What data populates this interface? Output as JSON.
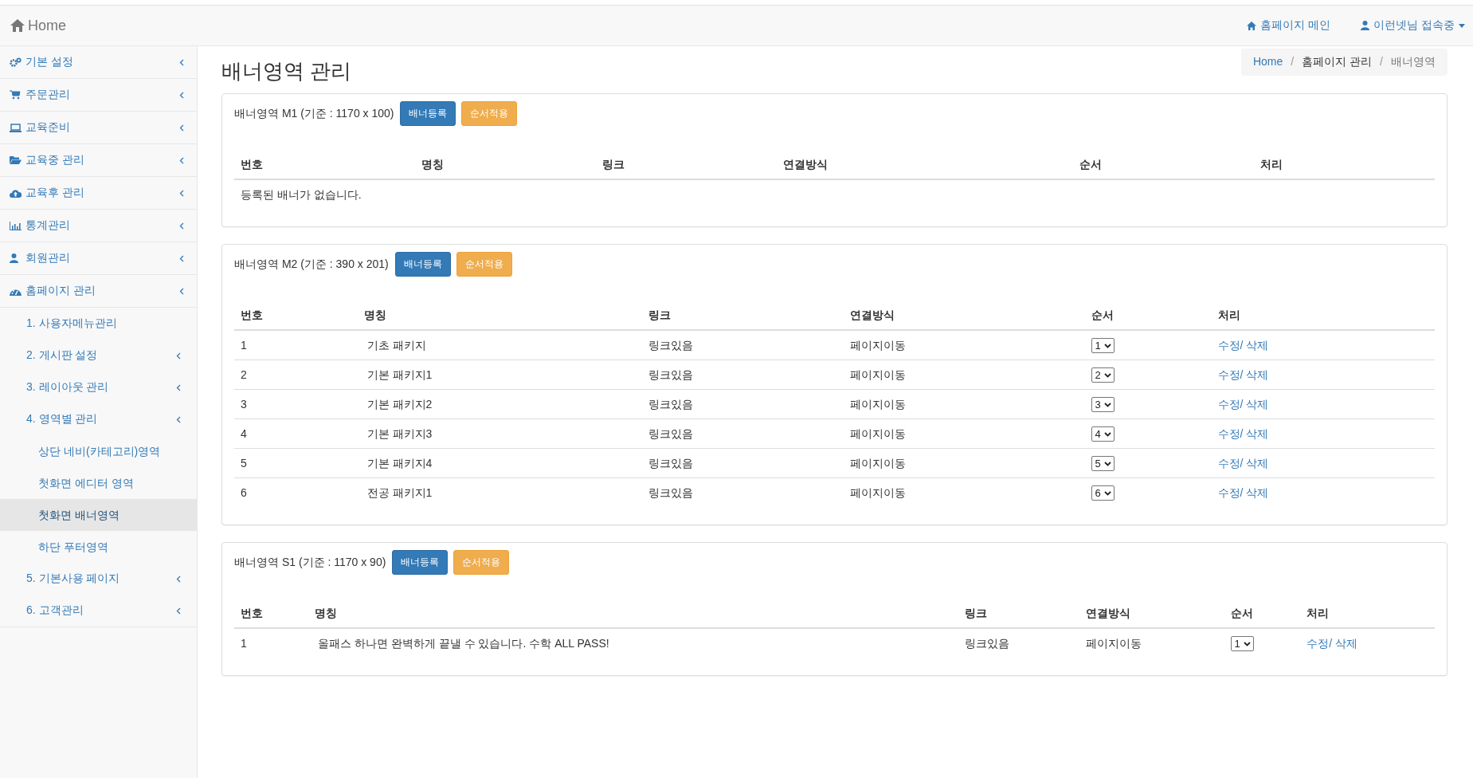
{
  "navbar": {
    "brand": "Home",
    "links": [
      {
        "label": "홈페이지 메인"
      },
      {
        "label": "이런넷님 접속중",
        "dropdown": true
      }
    ]
  },
  "sidebar": {
    "items": [
      {
        "label": "기본 설정",
        "has_submenu": true
      },
      {
        "label": "주문관리",
        "has_submenu": true
      },
      {
        "label": "교육준비",
        "has_submenu": true
      },
      {
        "label": "교육중 관리",
        "has_submenu": true
      },
      {
        "label": "교육후 관리",
        "has_submenu": true
      },
      {
        "label": "통계관리",
        "has_submenu": true
      },
      {
        "label": "회원관리",
        "has_submenu": true
      },
      {
        "label": "홈페이지 관리",
        "has_submenu": true,
        "children": [
          {
            "label": "1. 사용자메뉴관리",
            "has_submenu": false
          },
          {
            "label": "2. 게시판 설정",
            "has_submenu": true
          },
          {
            "label": "3. 레이아웃 관리",
            "has_submenu": true
          },
          {
            "label": "4. 영역별 관리",
            "has_submenu": true,
            "children": [
              {
                "label": "상단 네비(카테고리)영역",
                "selected": false
              },
              {
                "label": "첫화면 에디터 영역",
                "selected": false
              },
              {
                "label": "첫화면 배너영역",
                "selected": true
              },
              {
                "label": "하단 푸터영역",
                "selected": false
              }
            ]
          },
          {
            "label": "5. 기본사용 페이지",
            "has_submenu": true
          },
          {
            "label": "6. 고객관리",
            "has_submenu": true
          }
        ]
      }
    ]
  },
  "page_title": "배너영역 관리",
  "breadcrumb_separator": "/",
  "breadcrumb": [
    {
      "label": "Home",
      "kind": "link"
    },
    {
      "label": "홈페이지 관리",
      "kind": "text"
    },
    {
      "label": "배너영역",
      "kind": "active"
    }
  ],
  "panels": [
    {
      "title": "배너영역 M1 (기준 : 1170 x 100)",
      "buttons": [
        {
          "label": "배너등록",
          "kind": "primary"
        },
        {
          "label": "순서적용",
          "kind": "warning"
        }
      ],
      "columns": [
        "번호",
        "명칭",
        "링크",
        "연결방식",
        "순서",
        "처리"
      ],
      "empty_message": "등록된 배너가 없습니다."
    },
    {
      "title": "배너영역 M2 (기준 : 390 x 201)",
      "buttons": [
        {
          "label": "배너등록",
          "kind": "primary"
        },
        {
          "label": "순서적용",
          "kind": "warning"
        }
      ],
      "columns": [
        "번호",
        "명칭",
        "링크",
        "연결방식",
        "순서",
        "처리"
      ],
      "rows": [
        {
          "number": "1",
          "name": "기초 패키지",
          "link": "링크있음",
          "method": "페이지이동",
          "order": "1",
          "action": "수정/ 삭제"
        },
        {
          "number": "2",
          "name": "기본 패키지1",
          "link": "링크있음",
          "method": "페이지이동",
          "order": "2",
          "action": "수정/ 삭제"
        },
        {
          "number": "3",
          "name": "기본 패키지2",
          "link": "링크있음",
          "method": "페이지이동",
          "order": "3",
          "action": "수정/ 삭제"
        },
        {
          "number": "4",
          "name": "기본 패키지3",
          "link": "링크있음",
          "method": "페이지이동",
          "order": "4",
          "action": "수정/ 삭제"
        },
        {
          "number": "5",
          "name": "기본 패키지4",
          "link": "링크있음",
          "method": "페이지이동",
          "order": "5",
          "action": "수정/ 삭제"
        },
        {
          "number": "6",
          "name": "전공 패키지1",
          "link": "링크있음",
          "method": "페이지이동",
          "order": "6",
          "action": "수정/ 삭제"
        }
      ]
    },
    {
      "title": "배너영역 S1 (기준 : 1170 x 90)",
      "buttons": [
        {
          "label": "배너등록",
          "kind": "primary"
        },
        {
          "label": "순서적용",
          "kind": "warning"
        }
      ],
      "columns": [
        "번호",
        "명칭",
        "링크",
        "연결방식",
        "순서",
        "처리"
      ],
      "rows": [
        {
          "number": "1",
          "name": "올패스 하나면 완벽하게 끝낼 수 있습니다. 수학 ALL PASS!",
          "link": "링크있음",
          "method": "페이지이동",
          "order": "1",
          "action": "수정/ 삭제"
        }
      ]
    }
  ]
}
